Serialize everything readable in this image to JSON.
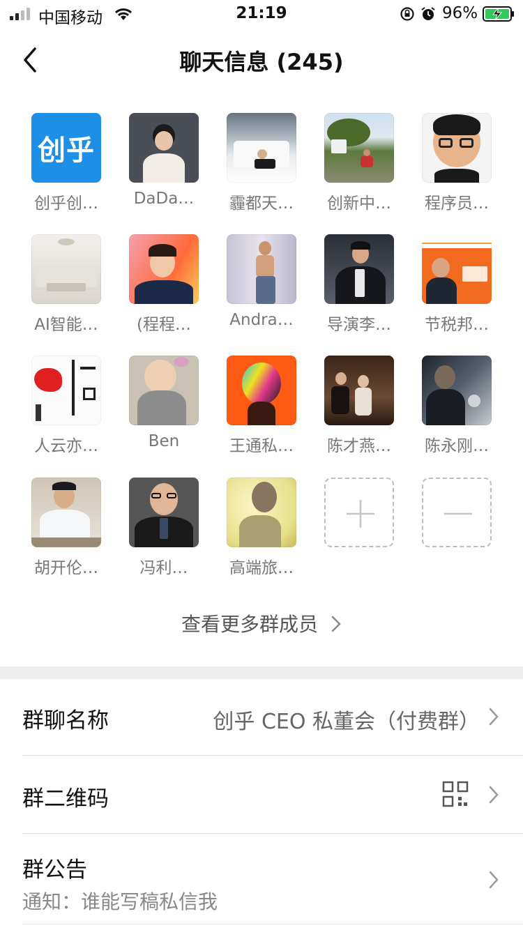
{
  "status_bar": {
    "carrier": "中国移动",
    "time": "21:19",
    "battery_percent": "96%"
  },
  "nav": {
    "title": "聊天信息 (245)"
  },
  "members": [
    {
      "name": "创乎创…",
      "avatar_text": "创乎"
    },
    {
      "name": "DaDa…"
    },
    {
      "name": "霾都天…"
    },
    {
      "name": "创新中…"
    },
    {
      "name": "程序员…"
    },
    {
      "name": "AI智能…"
    },
    {
      "name": "(程程…"
    },
    {
      "name": "Andra…"
    },
    {
      "name": "导演李…"
    },
    {
      "name": "节税邦…"
    },
    {
      "name": "人云亦…"
    },
    {
      "name": "Ben"
    },
    {
      "name": "王通私…"
    },
    {
      "name": "陈才燕…"
    },
    {
      "name": "陈永刚…"
    },
    {
      "name": "胡开伦…"
    },
    {
      "name": "冯利…"
    },
    {
      "name": "高端旅…"
    }
  ],
  "view_more": "查看更多群成员",
  "settings": {
    "group_name": {
      "label": "群聊名称",
      "value": "创乎 CEO 私董会（付费群）"
    },
    "qr_code": {
      "label": "群二维码"
    },
    "notice": {
      "label": "群公告",
      "value": "通知：谁能写稿私信我"
    }
  },
  "colors": {
    "accent_logo": "#1e8fe6",
    "battery_green": "#34c759",
    "separator": "#ededed"
  }
}
